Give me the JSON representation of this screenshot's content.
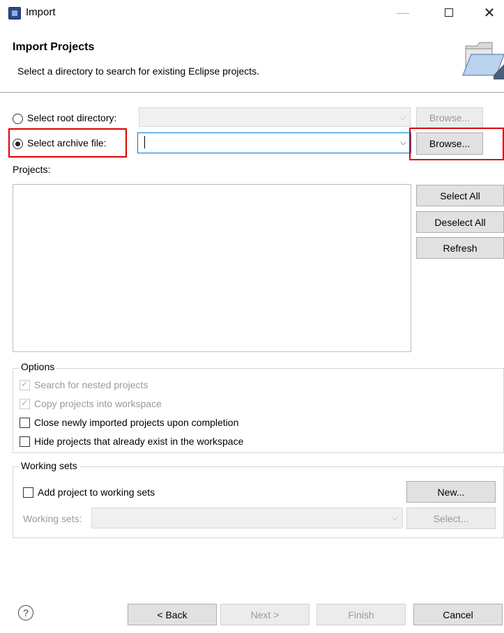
{
  "window": {
    "title": "Import",
    "minimize_glyph": "—",
    "close_glyph": "✕"
  },
  "header": {
    "title": "Import Projects",
    "description": "Select a directory to search for existing Eclipse projects."
  },
  "source": {
    "root_directory_label": "Select root directory:",
    "root_directory_value": "",
    "archive_file_label": "Select archive file:",
    "archive_file_value": "",
    "browse_label": "Browse...",
    "selected": "archive"
  },
  "projects": {
    "label": "Projects:",
    "items": [],
    "select_all_label": "Select All",
    "deselect_all_label": "Deselect All",
    "refresh_label": "Refresh"
  },
  "options": {
    "legend": "Options",
    "items": [
      {
        "label": "Search for nested projects",
        "checked": true,
        "enabled": false
      },
      {
        "label": "Copy projects into workspace",
        "checked": true,
        "enabled": false
      },
      {
        "label": "Close newly imported projects upon completion",
        "checked": false,
        "enabled": true
      },
      {
        "label": "Hide projects that already exist in the workspace",
        "checked": false,
        "enabled": true
      }
    ]
  },
  "working_sets": {
    "legend": "Working sets",
    "add_label": "Add project to working sets",
    "new_label": "New...",
    "sets_label": "Working sets:",
    "select_label": "Select..."
  },
  "footer": {
    "help_glyph": "?",
    "back_label": "< Back",
    "next_label": "Next >",
    "finish_label": "Finish",
    "cancel_label": "Cancel"
  },
  "colors": {
    "highlight": "#e00000",
    "focus": "#0078d7"
  }
}
